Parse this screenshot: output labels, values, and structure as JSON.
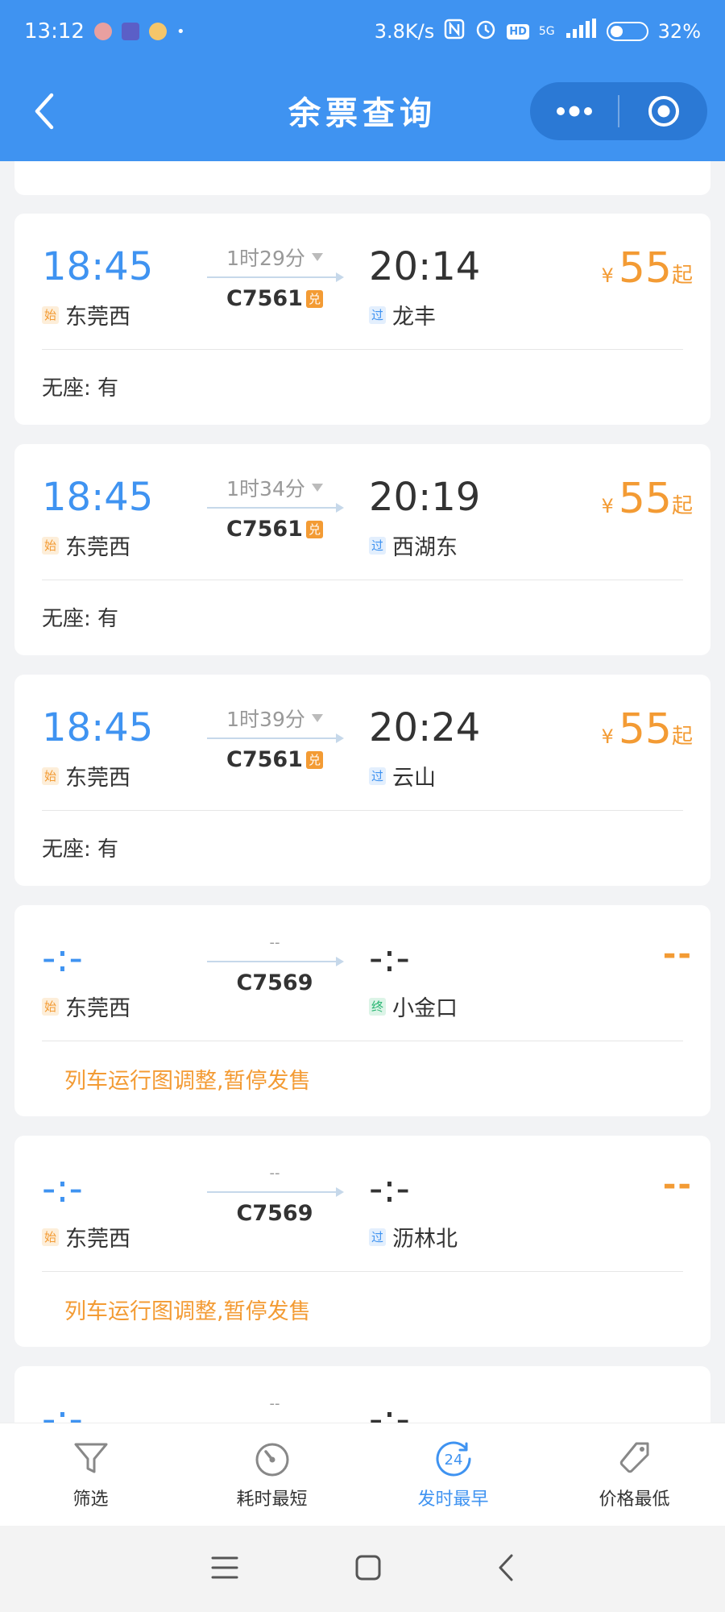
{
  "status_bar": {
    "time": "13:12",
    "speed": "3.8K/s",
    "network": "5G",
    "battery": "32",
    "battery_level": 0.32
  },
  "header": {
    "title": "余票查询",
    "back_icon": "chevron-left-icon",
    "more_icon": "more-dots-icon",
    "close_icon": "target-circle-icon"
  },
  "badges": {
    "start": "始",
    "pass": "过",
    "end": "终",
    "exchange": "兑"
  },
  "trains": [
    {
      "dep_time": "18:45",
      "dep_station": "东莞西",
      "dep_badge": "始",
      "duration": "1时29分",
      "train_no": "C7561",
      "train_badge": "兑",
      "arr_time": "20:14",
      "arr_station": "龙丰",
      "arr_badge": "过",
      "price_currency": "¥",
      "price": "55",
      "price_suffix": "起",
      "seat": "无座: 有"
    },
    {
      "dep_time": "18:45",
      "dep_station": "东莞西",
      "dep_badge": "始",
      "duration": "1时34分",
      "train_no": "C7561",
      "train_badge": "兑",
      "arr_time": "20:19",
      "arr_station": "西湖东",
      "arr_badge": "过",
      "price_currency": "¥",
      "price": "55",
      "price_suffix": "起",
      "seat": "无座: 有"
    },
    {
      "dep_time": "18:45",
      "dep_station": "东莞西",
      "dep_badge": "始",
      "duration": "1时39分",
      "train_no": "C7561",
      "train_badge": "兑",
      "arr_time": "20:24",
      "arr_station": "云山",
      "arr_badge": "过",
      "price_currency": "¥",
      "price": "55",
      "price_suffix": "起",
      "seat": "无座: 有"
    },
    {
      "dep_time": "-:-",
      "dep_station": "东莞西",
      "dep_badge": "始",
      "duration": "--",
      "train_no": "C7569",
      "arr_time": "-:-",
      "arr_station": "小金口",
      "arr_badge": "终",
      "price_dash": "--",
      "notice": "列车运行图调整,暂停发售"
    },
    {
      "dep_time": "-:-",
      "dep_station": "东莞西",
      "dep_badge": "始",
      "duration": "--",
      "train_no": "C7569",
      "arr_time": "-:-",
      "arr_station": "沥林北",
      "arr_badge": "过",
      "price_dash": "--",
      "notice": "列车运行图调整,暂停发售"
    },
    {
      "dep_time": "-:-",
      "duration": "--",
      "arr_time": "-:-"
    }
  ],
  "tabs": [
    {
      "label": "筛选",
      "icon": "filter-icon"
    },
    {
      "label": "耗时最短",
      "icon": "stopwatch-icon"
    },
    {
      "label": "发时最早",
      "icon": "clock-24-icon",
      "active": true
    },
    {
      "label": "价格最低",
      "icon": "price-tag-icon"
    }
  ],
  "system_nav": {
    "menu_icon": "menu-lines-icon",
    "home_icon": "home-square-icon",
    "back_icon": "nav-back-icon"
  },
  "colors": {
    "primary": "#3f93f1",
    "accent": "#f39b34",
    "green": "#2ab673"
  }
}
